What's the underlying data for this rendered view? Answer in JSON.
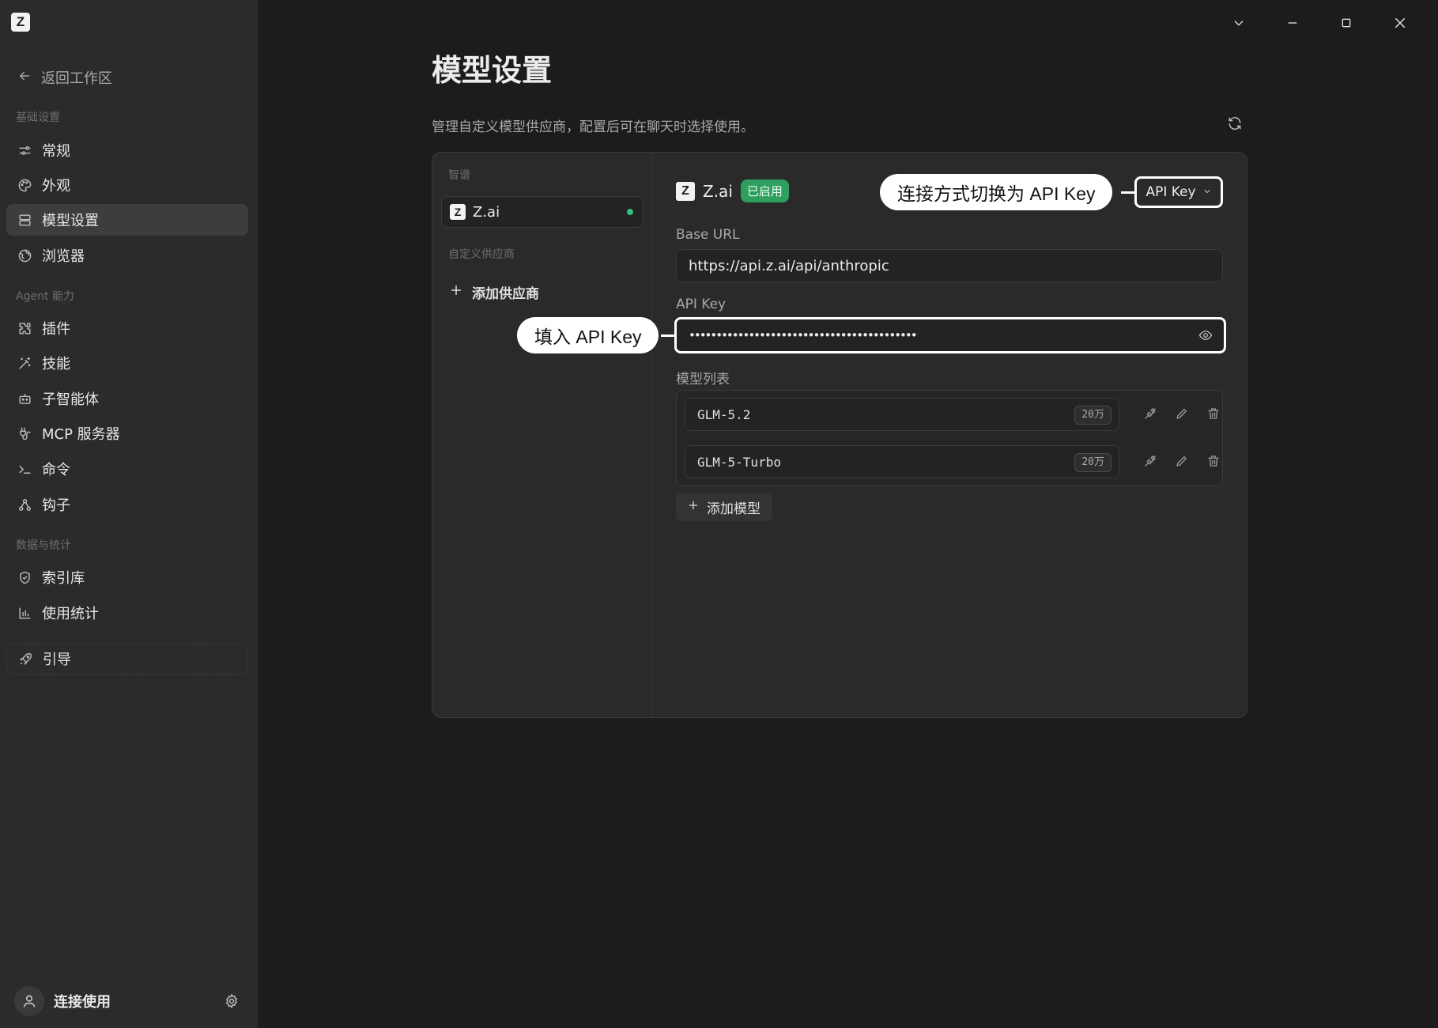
{
  "app": {
    "logo_letter": "Z"
  },
  "sidebar": {
    "back_label": "返回工作区",
    "sections": {
      "basic": "基础设置",
      "agent": "Agent 能力",
      "data": "数据与统计"
    },
    "items": [
      {
        "label": "常规",
        "icon": "sliders-icon"
      },
      {
        "label": "外观",
        "icon": "palette-icon"
      },
      {
        "label": "模型设置",
        "icon": "server-icon",
        "active": true
      },
      {
        "label": "浏览器",
        "icon": "globe-icon"
      },
      {
        "label": "插件",
        "icon": "puzzle-icon"
      },
      {
        "label": "技能",
        "icon": "wand-icon"
      },
      {
        "label": "子智能体",
        "icon": "bot-icon"
      },
      {
        "label": "MCP 服务器",
        "icon": "plug-icon"
      },
      {
        "label": "命令",
        "icon": "terminal-icon"
      },
      {
        "label": "钩子",
        "icon": "hook-icon"
      },
      {
        "label": "索引库",
        "icon": "shield-icon"
      },
      {
        "label": "使用统计",
        "icon": "bar-chart-icon"
      },
      {
        "label": "引导",
        "icon": "rocket-icon"
      }
    ],
    "user_label": "连接使用"
  },
  "main": {
    "title": "模型设置",
    "description": "管理自定义模型供应商，配置后可在聊天时选择使用。",
    "panel": {
      "group_builtin": "智谱",
      "builtin_provider": "Z.ai",
      "group_custom": "自定义供应商",
      "add_provider_label": "添加供应商",
      "provider_name": "Z.ai",
      "status_badge": "已启用",
      "connection_mode": "API Key",
      "base_url_label": "Base URL",
      "base_url_value": "https://api.z.ai/api/anthropic",
      "api_key_label": "API Key",
      "api_key_masked": "••••••••••••••••••••••••••••••••••••••••••",
      "model_list_label": "模型列表",
      "models": [
        {
          "name": "GLM-5.2",
          "context": "20万"
        },
        {
          "name": "GLM-5-Turbo",
          "context": "20万"
        }
      ],
      "add_model_label": "添加模型"
    }
  },
  "callouts": {
    "connection": "连接方式切换为 API Key",
    "api_key": "填入 API Key"
  },
  "colors": {
    "sidebar_bg": "#2b2b2b",
    "main_bg": "#1c1c1c",
    "active_item": "#3d3d3d",
    "enabled_badge": "#2f9f5f",
    "status_dot": "#34c27a"
  }
}
